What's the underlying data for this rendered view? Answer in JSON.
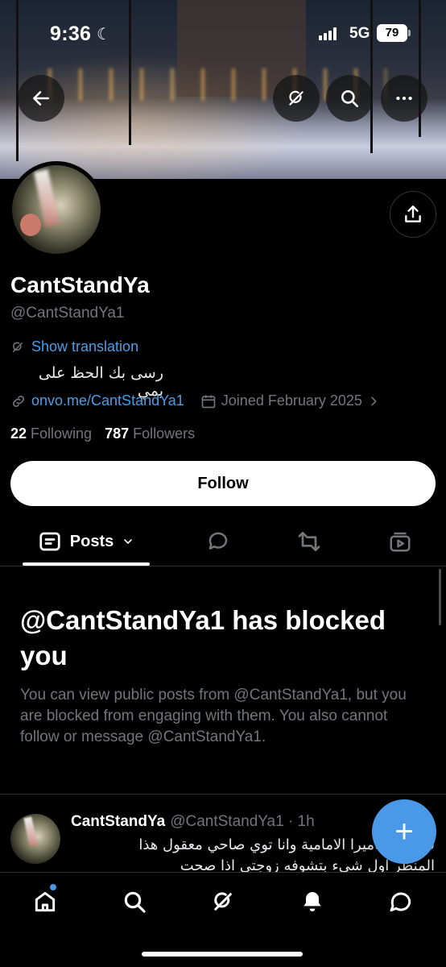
{
  "status_bar": {
    "time": "9:36",
    "network": "5G",
    "battery": "79"
  },
  "profile": {
    "display_name": "CantStandYa",
    "handle": "@CantStandYa1",
    "show_translation": "Show translation",
    "bio": "رسى بك الحظ على يمي",
    "link": "onvo.me/CantStandYa1",
    "joined": "Joined February 2025",
    "following_count": "22",
    "following_label": "Following",
    "followers_count": "787",
    "followers_label": "Followers"
  },
  "actions": {
    "follow": "Follow"
  },
  "tabs": {
    "posts": "Posts"
  },
  "blocked": {
    "title": "@CantStandYa1 has blocked you",
    "message": "You can view public posts from @CantStandYa1, but you are blocked from engaging with them. You also cannot follow or message @CantStandYa1."
  },
  "tweet": {
    "name": "CantStandYa",
    "handle_time": "@CantStandYa1 · 1h",
    "line1": "فتحت الكاميرا الامامية وانا توي صاحي معقول هذا",
    "line2": "المنظر اول شيء بتشوفه زوجتي اذا صحت"
  },
  "fab": {
    "label": "+"
  },
  "colors": {
    "accent": "#4a99e9",
    "link": "#4a9de6",
    "muted": "#71767b",
    "background": "#000000"
  },
  "icons": [
    "back-arrow-icon",
    "grok-icon",
    "search-icon",
    "more-icon",
    "share-icon",
    "translate-icon",
    "link-icon",
    "calendar-icon",
    "chevron-right-icon",
    "posts-tab-icon",
    "chevron-down-icon",
    "replies-icon",
    "retweet-icon",
    "media-icon",
    "home-icon",
    "explore-icon",
    "notifications-icon",
    "messages-icon"
  ]
}
